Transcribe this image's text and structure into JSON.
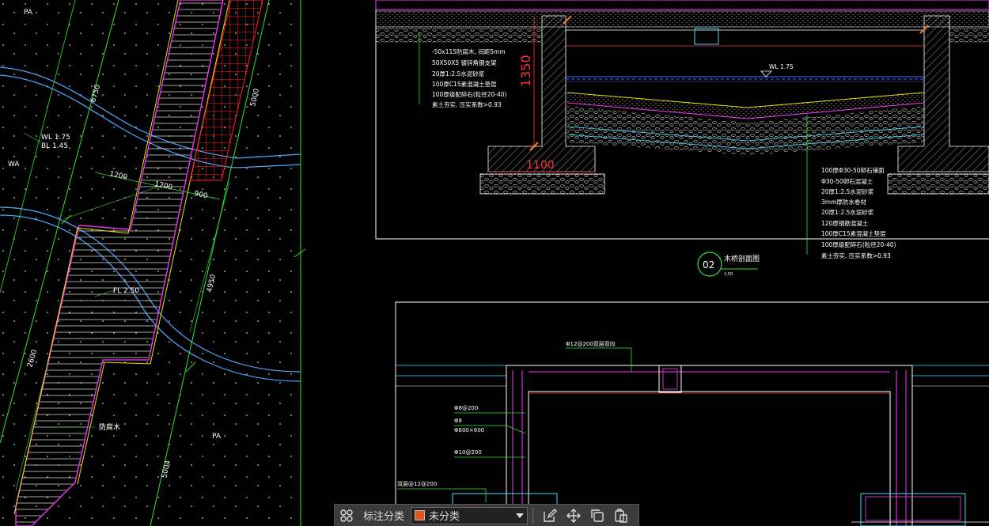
{
  "toolbar": {
    "category_label": "标注分类",
    "category_value": "未分类",
    "category_color": "#e0551a",
    "icons": [
      "annotation-group-icon",
      "edit-icon",
      "move-icon",
      "copy-icon",
      "paste-icon"
    ]
  },
  "plan": {
    "dims": [
      "6750",
      "5000",
      "1200",
      "1200",
      "900",
      "4950",
      "2600",
      "5004"
    ],
    "wl": "WL 1.75",
    "bl": "BL 1.45",
    "wa": "WA",
    "pa_top": "PA",
    "pa_bottom": "PA",
    "fl": "FL 2.50",
    "handrail": "防腐木"
  },
  "section": {
    "dim_height": "1350",
    "dim_width": "1100",
    "wl": "WL 1.75",
    "notes_left": [
      "-50x115防腐木, 间距5mm",
      "50X50X5 镀锌角钢支架",
      "20厚1:2.5水泥砂浆",
      "100厚C15素混凝土垫层",
      "100厚级配碎石(粒径20-40)",
      "素土夯实, 压实系数>0.93"
    ],
    "notes_right": [
      "100厚Φ30-50卵石铺面",
      "Φ30-50卵石混凝土",
      "20厚1:2.5水泥砂浆",
      "3mm厚防水卷材",
      "20厚1:2.5水泥砂浆",
      "120厚钢筋混凝土",
      "100厚C15素混凝土垫层",
      "100厚级配碎石(粒径20-40)",
      "素土夯实, 压实系数>0.93"
    ],
    "title_no": "02",
    "title": "木桥剖面图",
    "scale": "1:50"
  },
  "rebar": {
    "top": "Φ12@200双层双向",
    "n1": "Φ8@200",
    "n2": "Φ8",
    "n3": "Φ600×600",
    "n4": "Φ10@200",
    "n5": "双层@12@200"
  }
}
